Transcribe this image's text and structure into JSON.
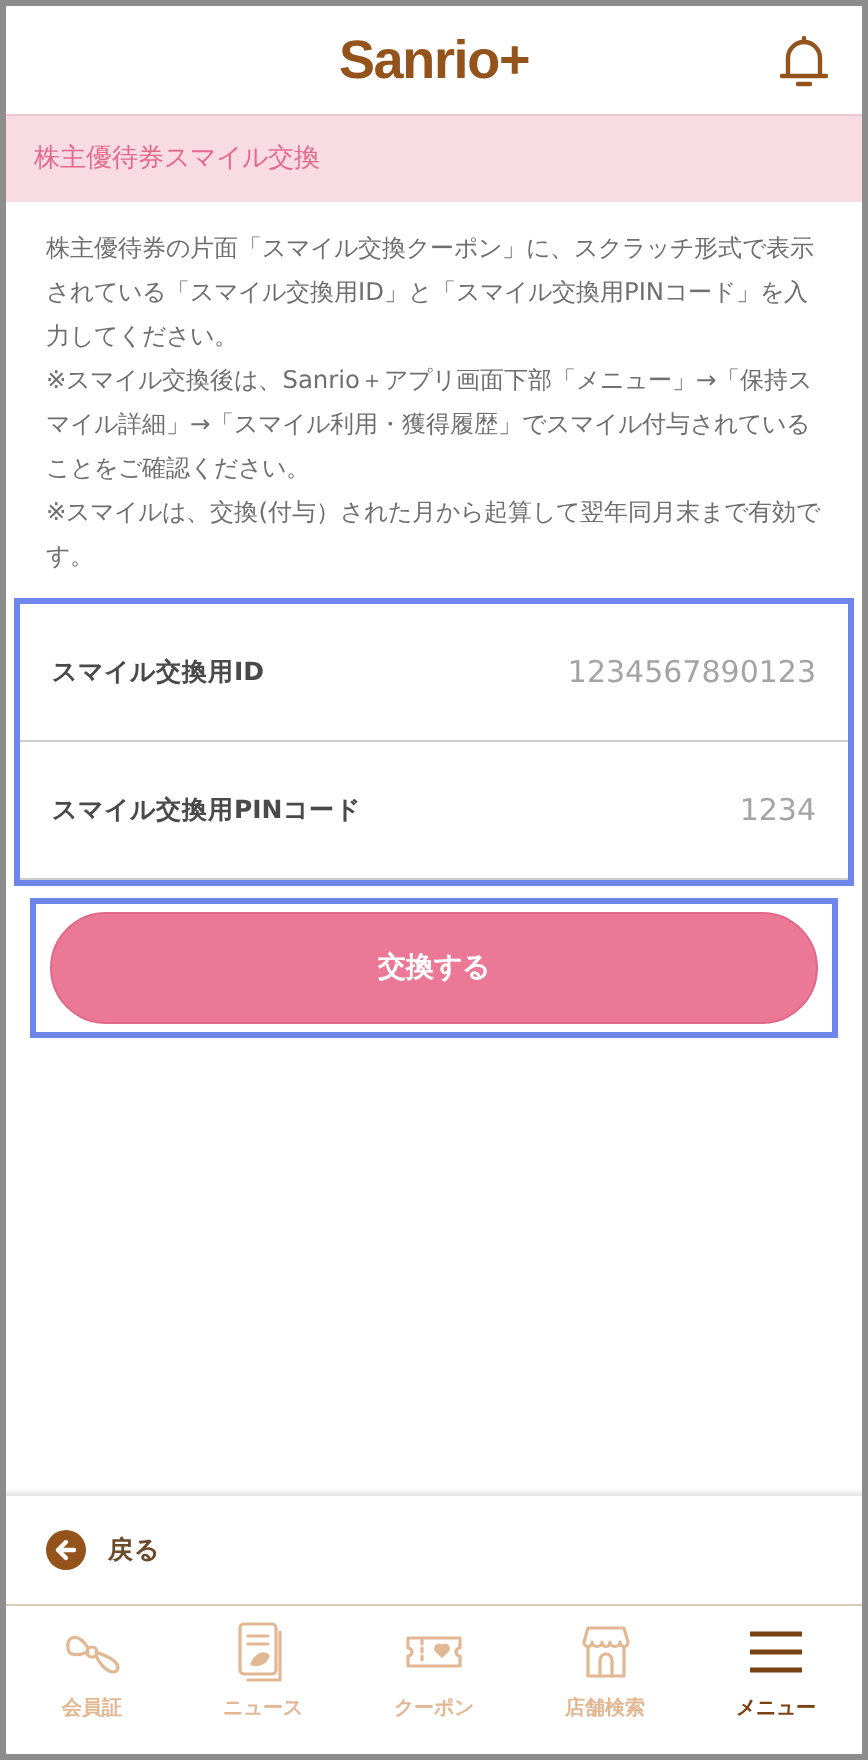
{
  "header": {
    "logo": "Sanrio+"
  },
  "section": {
    "title": "株主優待券スマイル交換"
  },
  "notes": [
    "株主優待券の片面「スマイル交換クーポン」に、スクラッチ形式で表示されている「スマイル交換用ID」と「スマイル交換用PINコード」を入力してください。",
    "※スマイル交換後は、Sanrio＋アプリ画面下部「メニュー」→「保持スマイル詳細」→「スマイル利用・獲得履歴」でスマイル付与されていることをご確認ください。",
    "※スマイルは、交換(付与）された月から起算して翌年同月末まで有効です。"
  ],
  "fields": [
    {
      "label": "スマイル交換用ID",
      "placeholder": "1234567890123"
    },
    {
      "label": "スマイル交換用PINコード",
      "placeholder": "1234"
    }
  ],
  "submit": "交換する",
  "back": "戻る",
  "tabs": [
    {
      "label": "会員証",
      "kind": "bow",
      "selected": false
    },
    {
      "label": "ニュース",
      "kind": "news",
      "selected": false
    },
    {
      "label": "クーポン",
      "kind": "coupon",
      "selected": false
    },
    {
      "label": "店舗検索",
      "kind": "store",
      "selected": false
    },
    {
      "label": "メニュー",
      "kind": "menu",
      "selected": true
    }
  ]
}
